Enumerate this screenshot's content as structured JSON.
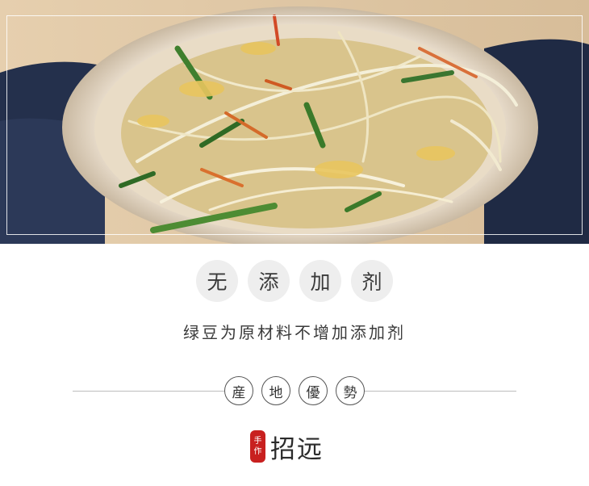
{
  "photo": {
    "description_icon": "noodle-dish-photo"
  },
  "badges": [
    "无",
    "添",
    "加",
    "剂"
  ],
  "subtitle": "绿豆为原材料不增加添加剂",
  "origin": [
    "産",
    "地",
    "優",
    "勢"
  ],
  "brand": {
    "seal_line1": "手",
    "seal_line2": "作",
    "name": "招远"
  }
}
